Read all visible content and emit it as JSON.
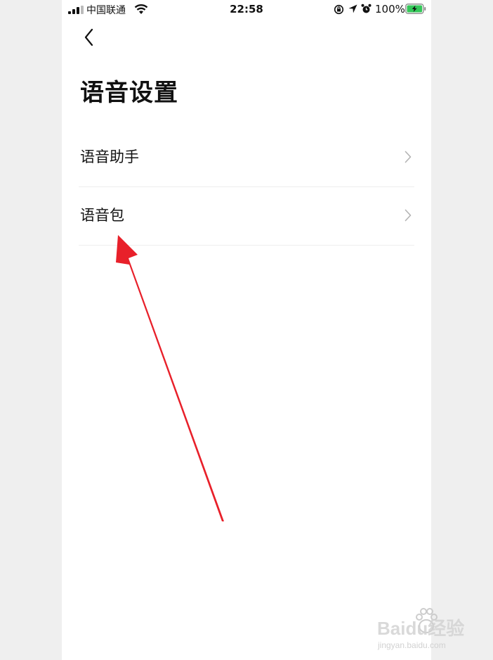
{
  "status_bar": {
    "carrier": "中国联通",
    "time": "22:58",
    "battery_percent": "100%",
    "battery_level": 1.0,
    "icons": [
      "signal-icon",
      "wifi-icon",
      "rotation-lock-icon",
      "location-arrow-icon",
      "alarm-icon",
      "battery-charging-icon"
    ]
  },
  "header": {
    "back_icon": "chevron-left-icon",
    "title": "语音设置"
  },
  "menu": {
    "items": [
      {
        "label": "语音助手",
        "icon": "chevron-right-icon"
      },
      {
        "label": "语音包",
        "icon": "chevron-right-icon"
      }
    ]
  },
  "annotation": {
    "type": "red-arrow",
    "points_to": "语音包",
    "color": "#e8202a"
  },
  "watermark": {
    "brand": "Baidu经验",
    "url": "jingyan.baidu.com"
  },
  "colors": {
    "background": "#ffffff",
    "outer_background": "#efefef",
    "text": "#111111",
    "divider": "#eeeeee",
    "chevron": "#b3b3b3",
    "battery_fill": "#34c759"
  }
}
